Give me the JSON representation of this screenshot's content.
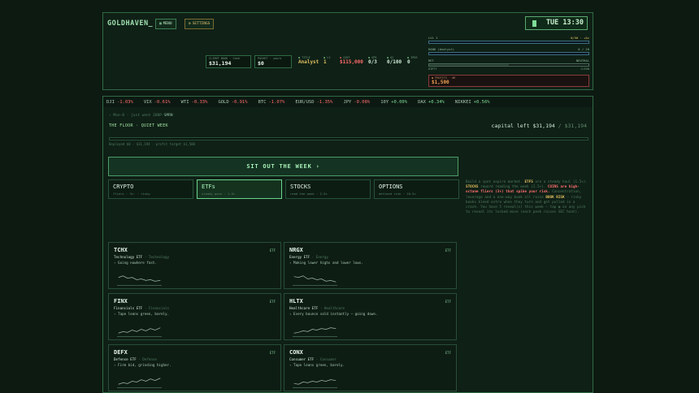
{
  "hud": {
    "brand": "GOLDHAVEN_",
    "menu_label": "MENU",
    "settings_label": "SETTINGS",
    "clock": "TUE 13:30",
    "cash_label": "CLIENT BOOK · Cash",
    "cash_value": "$31,194",
    "pocket_label": "POCKET · yours",
    "pocket_value": "$0",
    "title_label": "TITLE",
    "title_value": "Analyst",
    "lvl_label": "LV",
    "lvl_value": "1",
    "cost_label": "COST",
    "cost_value": "$115,000",
    "gps_label": "GPS",
    "gps_value": "0/3",
    "qc_label": "QC",
    "qc_value": "0/100",
    "ipo_label": "IPOS",
    "ipo_value": "0",
    "meter_lvl_left": "LVL 1",
    "meter_lvl_right": "0/50 · +$c",
    "meter_lvl_fraction": 0.0,
    "meter_rank_left": "RANK (Analyst)",
    "meter_rank_right": "0 / 20",
    "meter_rank_fraction": 0.0,
    "meter_ret_left": "RET",
    "meter_ret_right": "NEUTRAL",
    "meter_ret_fraction": 0.5,
    "ret_low": "DIRTY",
    "ret_high": "CLEAN",
    "profit_label": "PROFITS · WK",
    "profit_value": "$1,500"
  },
  "ticker": [
    {
      "sym": "DJI",
      "chg": "-1.03%",
      "dir": "down"
    },
    {
      "sym": "VIX",
      "chg": "-0.61%",
      "dir": "down"
    },
    {
      "sym": "WTI",
      "chg": "-0.33%",
      "dir": "down"
    },
    {
      "sym": "GOLD",
      "chg": "-0.91%",
      "dir": "down"
    },
    {
      "sym": "BTC",
      "chg": "-1.07%",
      "dir": "down"
    },
    {
      "sym": "EUR/USD",
      "chg": "-1.35%",
      "dir": "down"
    },
    {
      "sym": "JPY",
      "chg": "-0.08%",
      "dir": "down"
    },
    {
      "sym": "10Y",
      "chg": "+0.00%",
      "dir": "up"
    },
    {
      "sym": "DAX",
      "chg": "+0.34%",
      "dir": "up"
    },
    {
      "sym": "NIKKEI",
      "chg": "+0.56%",
      "dir": "up"
    }
  ],
  "main": {
    "crumb_prefix": "‹ Mon·0 · just went 200P·",
    "crumb_link": "SMRN",
    "floor": "THE FLOOR · QUIET WEEK",
    "capital_label": "capital left",
    "capital_value": "$31,194",
    "capital_total": "/ $31,194",
    "deployed": "Deployed $0 · $31,194 · profit target $1,500",
    "sit_out": "SIT OUT THE WEEK ›"
  },
  "tabs": [
    {
      "title": "CRYPTO",
      "sub": "fliers · 3×· · risky"
    },
    {
      "title": "ETFs",
      "sub": "steady pace · 1.5×"
    },
    {
      "title": "STOCKS",
      "sub": "read the week · 2.5×"
    },
    {
      "title": "OPTIONS",
      "sub": "defined risk · 10.5×"
    }
  ],
  "side": {
    "p1": "Build a spot aspire market.",
    "etfs": "ETFS",
    "p2": "are a steady haul (1.5×).",
    "stocks": "STOCKS",
    "p3": "reward reading the week (2.5×).",
    "coins": "COINS are high-octane fliers (3×) that spike your risk.",
    "p4": "Concentration, leverage and a one-way book all raise",
    "book_risk": "BOOK RISK",
    "p5": "— risky books bleed extra when they turn and get pulled in a crash. You have 5 reveal(s) this week — tap ◉ on any pick to reveal its locked move (each peek raises SEC heat)."
  },
  "cards": [
    {
      "ticker": "TCHX",
      "kind": "ETF",
      "name": "Technology ETF",
      "sector": "· Technology",
      "desc": "› Going nowhere fast."
    },
    {
      "ticker": "NRGX",
      "kind": "ETF",
      "name": "Energy ETF",
      "sector": "· Energy",
      "desc": "› Making lower highs and lower lows."
    },
    {
      "ticker": "FINX",
      "kind": "ETF",
      "name": "Financials ETF",
      "sector": "· Financials",
      "desc": "› Tape leans green, barely."
    },
    {
      "ticker": "HLTX",
      "kind": "ETF",
      "name": "Healthcare ETF",
      "sector": "· Healthcare",
      "desc": "› Every bounce sold instantly — going down."
    },
    {
      "ticker": "DEFX",
      "kind": "ETF",
      "name": "Defense ETF",
      "sector": "· Defense",
      "desc": "› Firm bid, grinding higher."
    },
    {
      "ticker": "CONX",
      "kind": "ETF",
      "name": "Consumer ETF",
      "sector": "· Consumer",
      "desc": "› Tape leans green, barely."
    }
  ],
  "colors": {
    "accent": "#7fdc98",
    "down": "#ff6b6b",
    "warn": "#e2c060"
  }
}
